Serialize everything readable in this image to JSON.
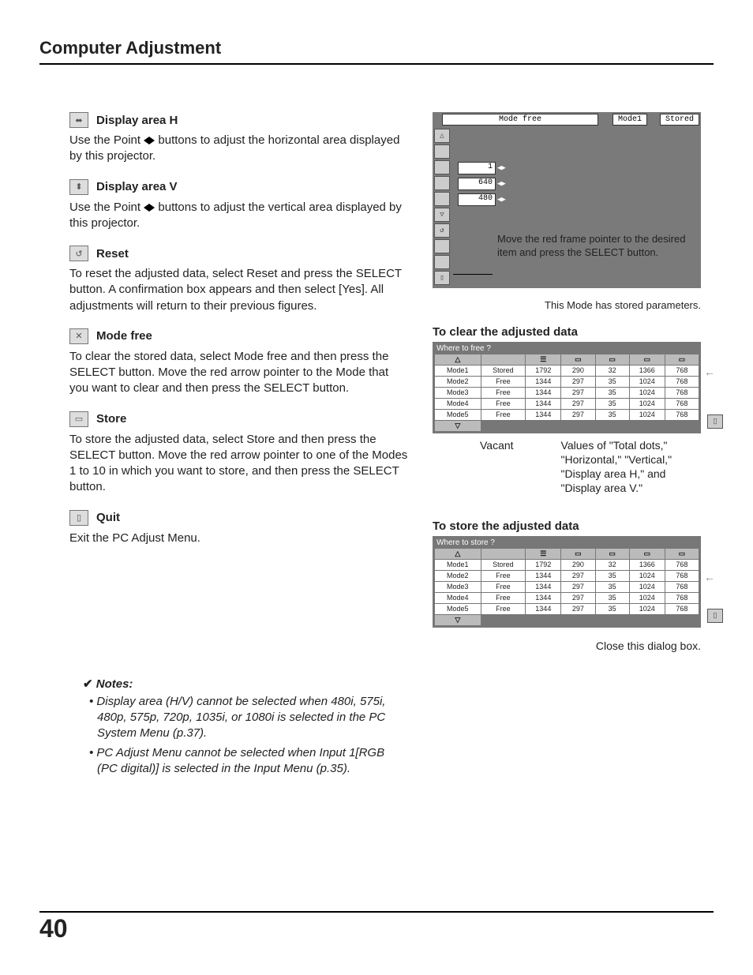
{
  "title": "Computer Adjustment",
  "page_number": "40",
  "sections": [
    {
      "title": "Display area H",
      "body_pre": "Use the Point ",
      "body_post": " buttons to adjust the horizontal area displayed by this projector."
    },
    {
      "title": "Display area V",
      "body_pre": "Use the Point ",
      "body_post": " buttons to adjust the vertical area displayed by this projector."
    },
    {
      "title": "Reset",
      "body": "To reset the adjusted data, select Reset and press the SELECT button. A confirmation box appears and then select [Yes]. All adjustments will return to their previous figures."
    },
    {
      "title": "Mode free",
      "body": "To clear the stored data, select Mode free and then press the SELECT button. Move the red arrow pointer to the Mode that you want to clear and then press the SELECT button."
    },
    {
      "title": "Store",
      "body": "To store the adjusted data, select Store and then press the SELECT button. Move the red arrow pointer to one of the Modes 1 to 10 in which you want to store, and then press the SELECT button."
    },
    {
      "title": "Quit",
      "body": "Exit the PC Adjust Menu."
    }
  ],
  "panel1": {
    "tabs": [
      "Mode free",
      "Mode1",
      "Stored"
    ],
    "values": [
      "1",
      "640",
      "480"
    ],
    "note": "Move the red frame pointer to the desired item and press the SELECT button."
  },
  "stored_note": "This Mode has stored parameters.",
  "clear": {
    "heading": "To clear the adjusted data",
    "dlg_title": "Where to free ?",
    "rows": [
      {
        "mode": "Mode1",
        "status": "Stored",
        "v": [
          "1792",
          "290",
          "32",
          "1366",
          "768"
        ]
      },
      {
        "mode": "Mode2",
        "status": "Free",
        "v": [
          "1344",
          "297",
          "35",
          "1024",
          "768"
        ]
      },
      {
        "mode": "Mode3",
        "status": "Free",
        "v": [
          "1344",
          "297",
          "35",
          "1024",
          "768"
        ]
      },
      {
        "mode": "Mode4",
        "status": "Free",
        "v": [
          "1344",
          "297",
          "35",
          "1024",
          "768"
        ]
      },
      {
        "mode": "Mode5",
        "status": "Free",
        "v": [
          "1344",
          "297",
          "35",
          "1024",
          "768"
        ]
      }
    ],
    "callout_left": "Vacant",
    "callout_right": "Values of \"Total dots,\" \"Horizontal,\" \"Vertical,\" \"Display area H,\" and \"Display area V.\""
  },
  "store": {
    "heading": "To store the adjusted data",
    "dlg_title": "Where to store ?",
    "rows": [
      {
        "mode": "Mode1",
        "status": "Stored",
        "v": [
          "1792",
          "290",
          "32",
          "1366",
          "768"
        ]
      },
      {
        "mode": "Mode2",
        "status": "Free",
        "v": [
          "1344",
          "297",
          "35",
          "1024",
          "768"
        ]
      },
      {
        "mode": "Mode3",
        "status": "Free",
        "v": [
          "1344",
          "297",
          "35",
          "1024",
          "768"
        ]
      },
      {
        "mode": "Mode4",
        "status": "Free",
        "v": [
          "1344",
          "297",
          "35",
          "1024",
          "768"
        ]
      },
      {
        "mode": "Mode5",
        "status": "Free",
        "v": [
          "1344",
          "297",
          "35",
          "1024",
          "768"
        ]
      }
    ],
    "callout": "Close this dialog box."
  },
  "notes": {
    "heading": "Notes:",
    "items": [
      "Display area (H/V) cannot be selected when 480i, 575i, 480p, 575p, 720p, 1035i, or 1080i is selected in the PC System Menu (p.37).",
      "PC Adjust Menu cannot be selected when Input 1[RGB (PC digital)] is selected in the Input Menu (p.35)."
    ]
  }
}
